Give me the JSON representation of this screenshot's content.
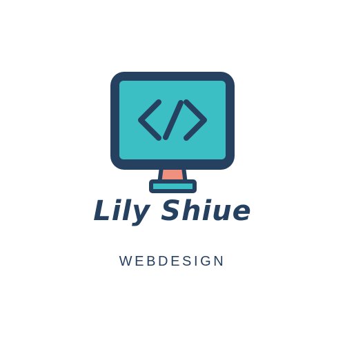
{
  "logo": {
    "brand_name": "Lily Shiue",
    "tagline": "WEBDESIGN",
    "icon": "monitor-code-icon",
    "colors": {
      "background": "#ffffff",
      "dark_navy": "#264060",
      "screen_teal": "#3bbfc4",
      "stand_salmon": "#f0907f",
      "base_teal": "#3bbfc4"
    }
  }
}
